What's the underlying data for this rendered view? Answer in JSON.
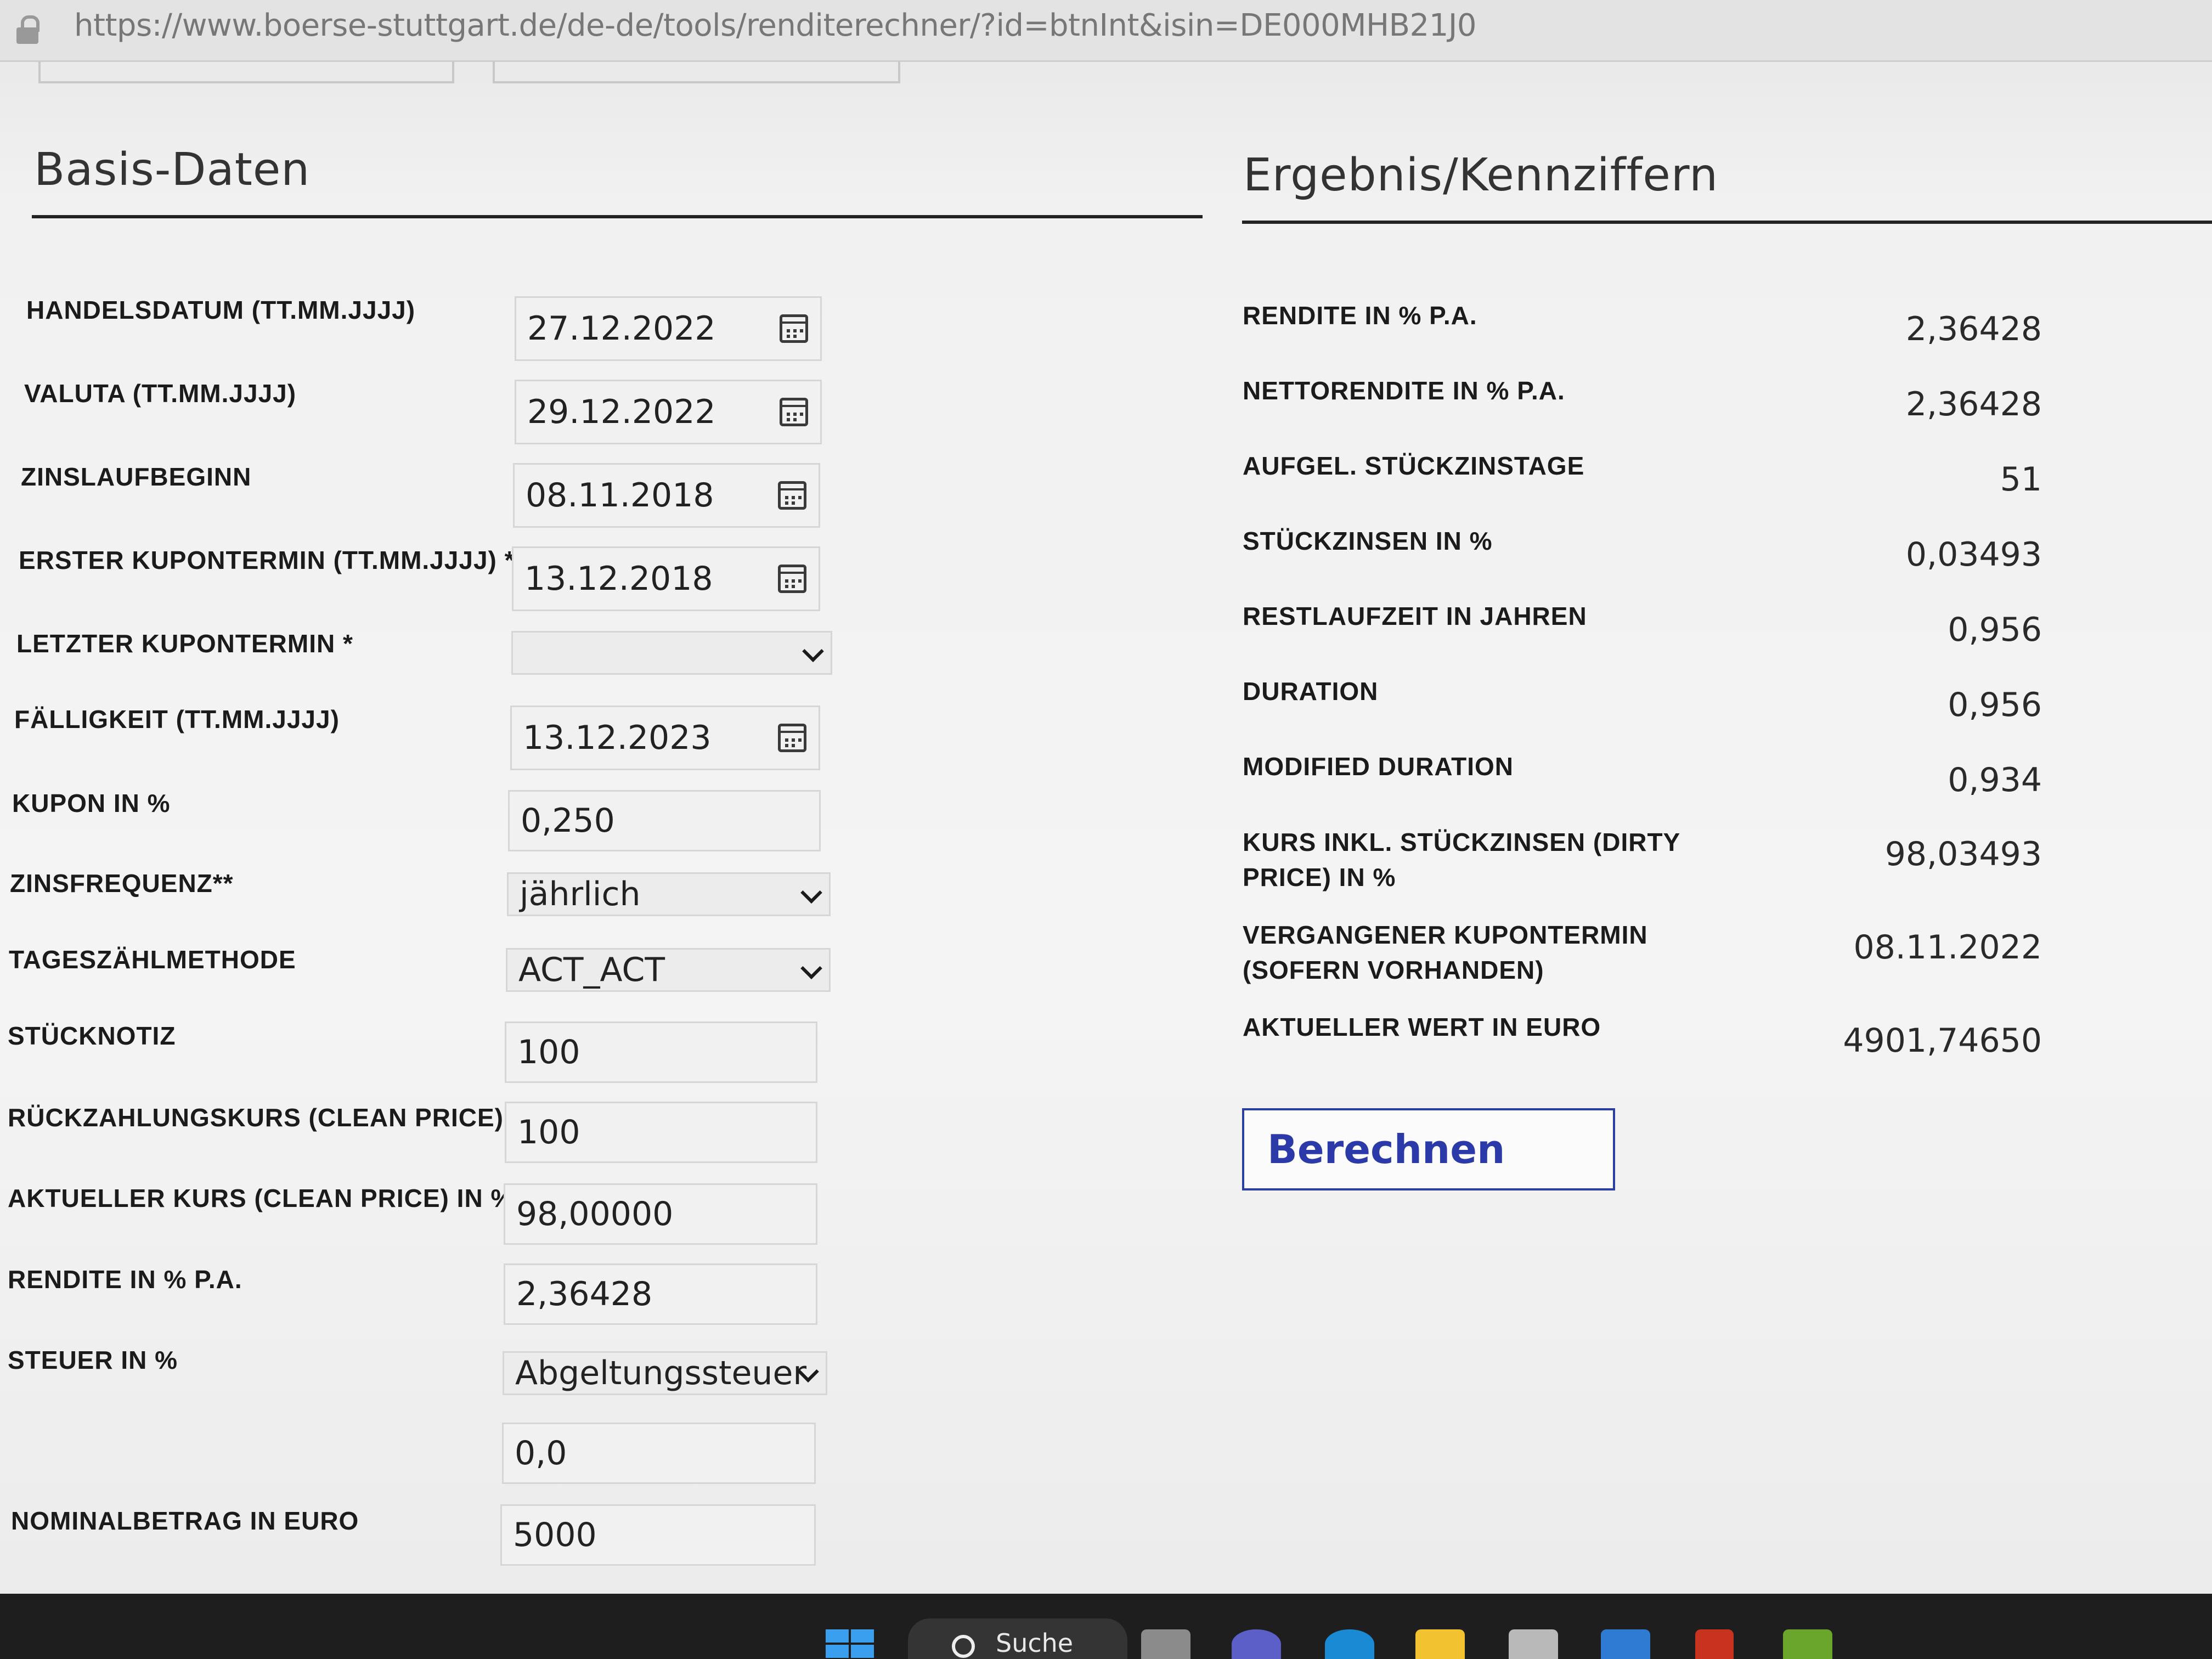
{
  "browser": {
    "url": "https://www.boerse-stuttgart.de/de-de/tools/renditerechner/?id=btnInt&isin=DE000MHB21J0"
  },
  "basis": {
    "title": "Basis-Daten",
    "handelsdatum": {
      "label": "HANDELSDATUM (TT.MM.JJJJ)",
      "value": "27.12.2022"
    },
    "valuta": {
      "label": "VALUTA (TT.MM.JJJJ)",
      "value": "29.12.2022"
    },
    "zinslaufbeginn": {
      "label": "ZINSLAUFBEGINN",
      "value": "08.11.2018"
    },
    "erster_kupontermin": {
      "label": "ERSTER KUPONTERMIN (TT.MM.JJJJ) *",
      "value": "13.12.2018"
    },
    "letzter_kupontermin": {
      "label": "LETZTER KUPONTERMIN *",
      "value": ""
    },
    "faelligkeit": {
      "label": "FÄLLIGKEIT (TT.MM.JJJJ)",
      "value": "13.12.2023"
    },
    "kupon": {
      "label": "KUPON IN %",
      "value": "0,250"
    },
    "zinsfrequenz": {
      "label": "ZINSFREQUENZ**",
      "value": "jährlich"
    },
    "tageszaehlmethode": {
      "label": "TAGESZÄHLMETHODE",
      "value": "ACT_ACT"
    },
    "stuecknotiz": {
      "label": "STÜCKNOTIZ",
      "value": "100"
    },
    "rueckzahlungskurs": {
      "label": "RÜCKZAHLUNGSKURS (CLEAN PRICE)",
      "value": "100"
    },
    "aktueller_kurs": {
      "label": "AKTUELLER KURS (CLEAN PRICE) IN %",
      "value": "98,00000"
    },
    "rendite": {
      "label": "RENDITE IN % P.A.",
      "value": "2,36428"
    },
    "steuer": {
      "label": "STEUER IN %",
      "value": "Abgeltungssteuer"
    },
    "steuer_satz": {
      "value": "0,0"
    },
    "nominalbetrag": {
      "label": "NOMINALBETRAG IN EURO",
      "value": "5000"
    }
  },
  "ergebnis": {
    "title": "Ergebnis/Kennziffern",
    "rows": [
      {
        "label": "RENDITE IN % P.A.",
        "value": "2,36428"
      },
      {
        "label": "NETTORENDITE IN % P.A.",
        "value": "2,36428"
      },
      {
        "label": "AUFGEL. STÜCKZINSTAGE",
        "value": "51"
      },
      {
        "label": "STÜCKZINSEN IN %",
        "value": "0,03493"
      },
      {
        "label": "RESTLAUFZEIT IN JAHREN",
        "value": "0,956"
      },
      {
        "label": "DURATION",
        "value": "0,956"
      },
      {
        "label": "MODIFIED DURATION",
        "value": "0,934"
      },
      {
        "label": "KURS INKL. STÜCKZINSEN (DIRTY PRICE) IN %",
        "value": "98,03493"
      },
      {
        "label": "VERGANGENER KUPONTERMIN (SOFERN VORHANDEN)",
        "value": "08.11.2022"
      },
      {
        "label": "AKTUELLER WERT IN EURO",
        "value": "4901,74650"
      }
    ],
    "button_label": "Berechnen"
  },
  "taskbar": {
    "search_label": "Suche"
  },
  "colors": {
    "button_text": "#2b3aa8",
    "button_border": "#2b3f9f",
    "taskbar": "#1e1e1e"
  }
}
